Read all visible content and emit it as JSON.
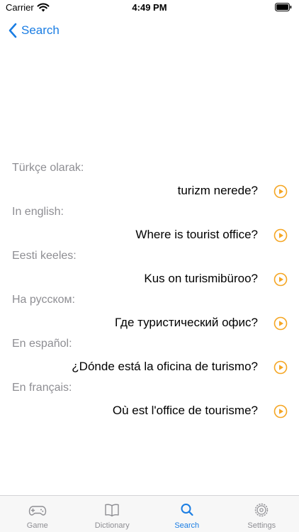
{
  "status_bar": {
    "carrier": "Carrier",
    "time": "4:49 PM"
  },
  "nav": {
    "back_label": "Search"
  },
  "accent_color": "#f5a623",
  "phrases": [
    {
      "language_label": "Türkçe olarak:",
      "text": "turizm nerede?"
    },
    {
      "language_label": "In english:",
      "text": "Where is tourist office?"
    },
    {
      "language_label": "Eesti keeles:",
      "text": "Kus on turismibüroo?"
    },
    {
      "language_label": "На русском:",
      "text": "Где туристический офис?"
    },
    {
      "language_label": "En español:",
      "text": "¿Dónde está la oficina de turismo?"
    },
    {
      "language_label": "En français:",
      "text": "Où est l'office de tourisme?"
    }
  ],
  "tab_bar": {
    "tabs": [
      {
        "label": "Game",
        "icon": "gamepad-icon",
        "active": false
      },
      {
        "label": "Dictionary",
        "icon": "book-icon",
        "active": false
      },
      {
        "label": "Search",
        "icon": "search-icon",
        "active": true
      },
      {
        "label": "Settings",
        "icon": "gear-icon",
        "active": false
      }
    ]
  }
}
